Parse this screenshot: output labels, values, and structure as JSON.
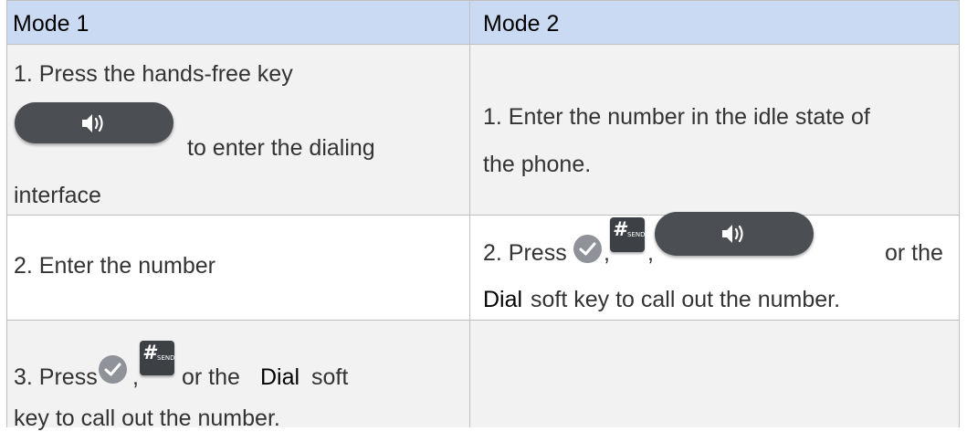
{
  "headers": [
    "Mode 1",
    "Mode 2"
  ],
  "rows": [
    {
      "mode1": {
        "line1": "1. Press the hands-free key",
        "line2": "to enter the dialing",
        "line3": "interface"
      },
      "mode2": {
        "line1": "1. Enter the number in the idle state of",
        "line2": "the phone."
      }
    },
    {
      "mode1": {
        "line1": "2. Enter the number"
      },
      "mode2": {
        "prefix": "2. Press",
        "sep1": ",",
        "sep2": ",",
        "suffix": "or the",
        "bold": "Dial",
        "line2_rest": "soft key to call out the number."
      }
    },
    {
      "mode1": {
        "prefix": "3. Press",
        "sep1": ",",
        "suffix": "or the",
        "bold": "Dial",
        "suffix2": "soft",
        "line2": "key to call out the number."
      },
      "mode2": {}
    }
  ],
  "keys": {
    "send_key": {
      "hash": "#",
      "label": "SEND"
    }
  },
  "icons": [
    "speaker-icon",
    "check-icon"
  ],
  "colors": {
    "header_bg": "#c9daf2",
    "row_gray": "#f2f2f2",
    "border": "#bfbfbf",
    "key_dark": "#4b4e53",
    "check_gray": "#8f9299"
  }
}
